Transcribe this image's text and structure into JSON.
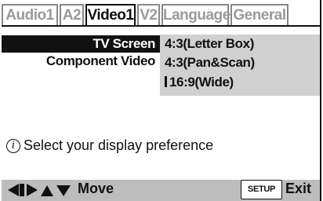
{
  "tabs": [
    {
      "label": "Audio1",
      "active": false
    },
    {
      "label": "A2",
      "active": false
    },
    {
      "label": "Video1",
      "active": true
    },
    {
      "label": "V2",
      "active": false
    },
    {
      "label": "Language",
      "active": false
    },
    {
      "label": "General",
      "active": false
    }
  ],
  "menu": {
    "items": [
      {
        "label": "TV Screen",
        "selected": true
      },
      {
        "label": "Component Video",
        "selected": false
      }
    ],
    "options": [
      {
        "label": "4:3(Letter Box)",
        "current": false
      },
      {
        "label": "4:3(Pan&Scan)",
        "current": false
      },
      {
        "label": "16:9(Wide)",
        "current": true
      }
    ]
  },
  "info": {
    "icon": "info-icon",
    "text": "Select your display preference"
  },
  "footer": {
    "move_label": "Move",
    "setup_label": "SETUP",
    "exit_label": "Exit"
  },
  "colors": {
    "selection_bg": "#111111",
    "panel_bg": "#d0d0d0",
    "footer_bg": "#bdbdbd",
    "inactive_tab_text": "#9a9a9a"
  }
}
